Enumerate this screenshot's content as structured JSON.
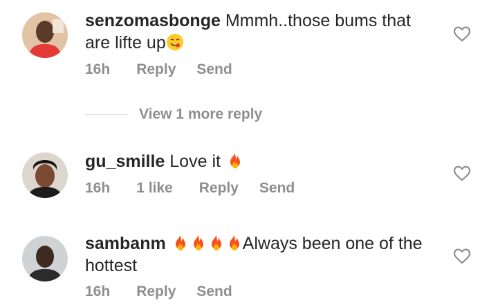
{
  "comments": [
    {
      "username": "senzomasbonge",
      "text": "Mmmh..those bums that are lifte up",
      "emoji": "yum-face",
      "time": "16h",
      "likes": "",
      "reply": "Reply",
      "send": "Send"
    },
    {
      "username": "gu_smille",
      "text": "Love it",
      "emoji": "fire",
      "time": "16h",
      "likes": "1 like",
      "reply": "Reply",
      "send": "Send"
    },
    {
      "username": "sambanm",
      "text_after_emojis": "Always been one of the hottest",
      "emoji": "fire",
      "emoji_count": 4,
      "time": "16h",
      "likes": "",
      "reply": "Reply",
      "send": "Send"
    }
  ],
  "view_more_replies": "View 1 more reply",
  "colors": {
    "text": "#262626",
    "meta": "#8e8e8e",
    "divider": "#c7c7c7"
  },
  "icons": [
    "heart-outline-icon",
    "fire-emoji",
    "yum-face-emoji"
  ]
}
